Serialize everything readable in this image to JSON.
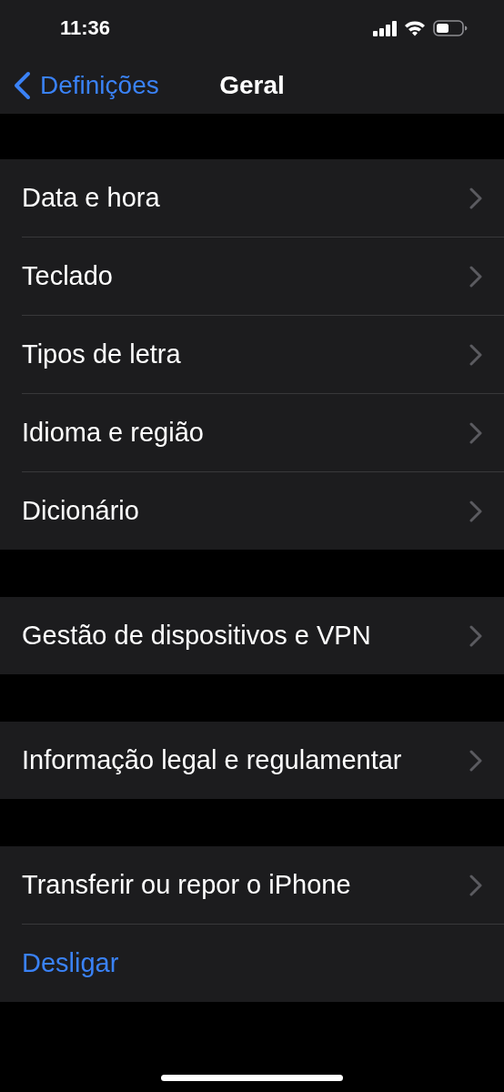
{
  "status_bar": {
    "time": "11:36"
  },
  "nav": {
    "back_label": "Definições",
    "title": "Geral"
  },
  "groups": [
    {
      "rows": [
        {
          "label": "Data e hora",
          "kind": "link"
        },
        {
          "label": "Teclado",
          "kind": "link"
        },
        {
          "label": "Tipos de letra",
          "kind": "link"
        },
        {
          "label": "Idioma e região",
          "kind": "link"
        },
        {
          "label": "Dicionário",
          "kind": "link"
        }
      ]
    },
    {
      "rows": [
        {
          "label": "Gestão de dispositivos e VPN",
          "kind": "link"
        }
      ]
    },
    {
      "rows": [
        {
          "label": "Informação legal e regulamentar",
          "kind": "link"
        }
      ]
    },
    {
      "rows": [
        {
          "label": "Transferir ou repor o iPhone",
          "kind": "link"
        },
        {
          "label": "Desligar",
          "kind": "action"
        }
      ]
    }
  ]
}
